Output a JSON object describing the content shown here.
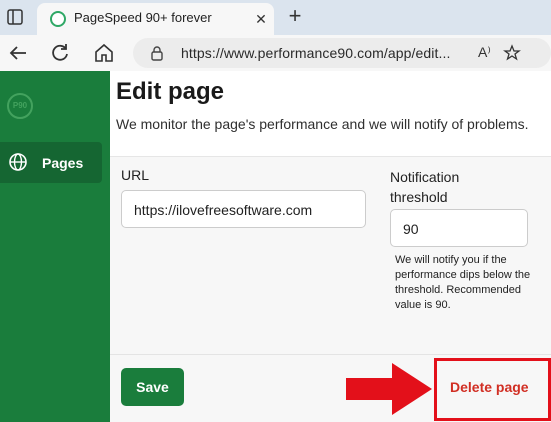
{
  "browser": {
    "tab": {
      "title": "PageSpeed 90+ forever"
    },
    "address_bar": {
      "url": "https://www.performance90.com/app/edit..."
    }
  },
  "sidebar": {
    "logo_text": "P90",
    "items": [
      {
        "label": "Pages",
        "icon": "globe-icon"
      }
    ]
  },
  "main": {
    "title": "Edit page",
    "description": "We monitor the page's performance and we will notify of problems.",
    "form": {
      "url_label": "URL",
      "url_value": "https://ilovefreesoftware.com",
      "threshold_label": "Notification threshold",
      "threshold_value": "90",
      "threshold_help": "We will notify you if the performance dips below the threshold. Recommended value is 90."
    },
    "actions": {
      "save_label": "Save",
      "delete_label": "Delete page"
    }
  },
  "colors": {
    "brand_green": "#1a7d3c",
    "annotation_red": "#e3101a",
    "delete_text": "#d12f24"
  }
}
